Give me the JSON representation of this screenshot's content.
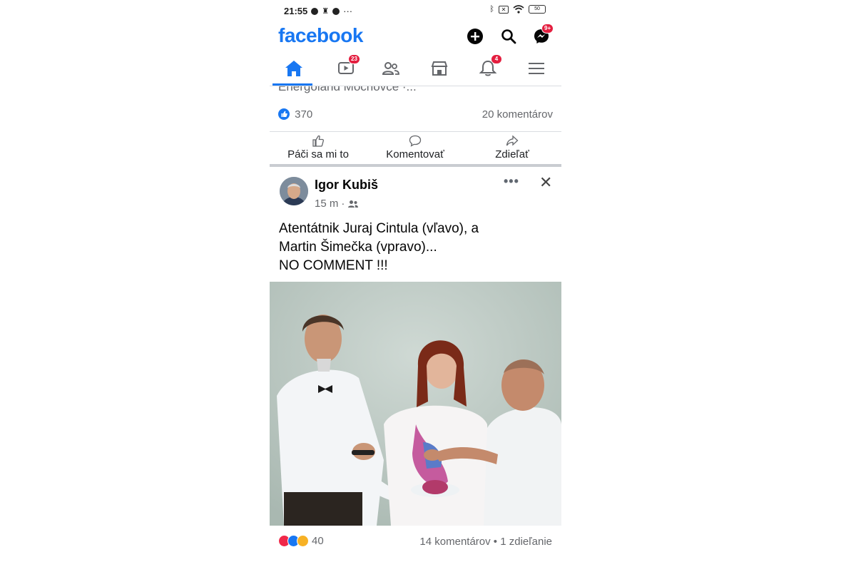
{
  "status_bar": {
    "time": "21:55",
    "dots": "···",
    "battery": "50"
  },
  "header": {
    "logo": "facebook",
    "messenger_badge": "9+"
  },
  "tabs": [
    {
      "name": "home",
      "icon": "home-icon",
      "active": true
    },
    {
      "name": "watch",
      "icon": "video-icon",
      "badge": "23"
    },
    {
      "name": "friends",
      "icon": "friends-icon"
    },
    {
      "name": "marketplace",
      "icon": "store-icon"
    },
    {
      "name": "notifications",
      "icon": "bell-icon",
      "badge": "4"
    },
    {
      "name": "menu",
      "icon": "menu-icon"
    }
  ],
  "previous_post": {
    "link_text": "Energoland Mochovce ·...",
    "likes": "370",
    "comments": "20 komentárov",
    "actions": {
      "like": "Páči sa mi to",
      "comment": "Komentovať",
      "share": "Zdieľať"
    }
  },
  "post": {
    "author": "Igor Kubiš",
    "time": "15 m",
    "separator": "·",
    "text_line1": "Atentátnik Juraj Cintula (vľavo), a",
    "text_line2": "Martin Šimečka (vpravo)...",
    "text_line3": "NO COMMENT !!!",
    "reaction_count": "40",
    "comments_shares": "14 komentárov • 1 zdieľanie"
  },
  "colors": {
    "brand": "#1877f2",
    "badge": "#e41e3f",
    "muted": "#65676b"
  }
}
